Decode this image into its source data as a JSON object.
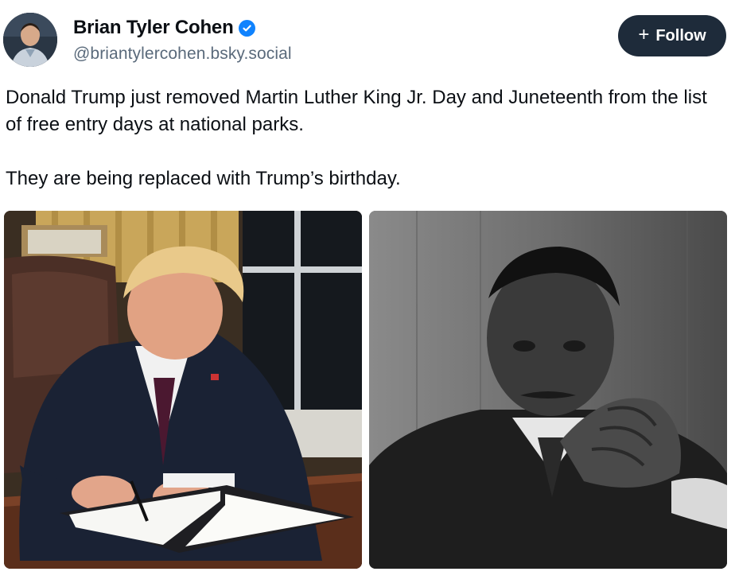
{
  "author": {
    "display_name": "Brian Tyler Cohen",
    "handle": "@briantylercohen.bsky.social",
    "verified": true,
    "avatar_icon": "profile-photo"
  },
  "follow": {
    "label": "Follow",
    "icon": "plus-icon"
  },
  "post": {
    "paragraphs": [
      "Donald Trump just removed Martin Luther King Jr. Day and Juneteenth from the list of free entry days at national parks.",
      "They are being replaced with Trump’s birthday."
    ]
  },
  "colors": {
    "follow_bg": "#1e2b3a",
    "verified": "#1083fe",
    "handle": "#5a6a7b"
  }
}
